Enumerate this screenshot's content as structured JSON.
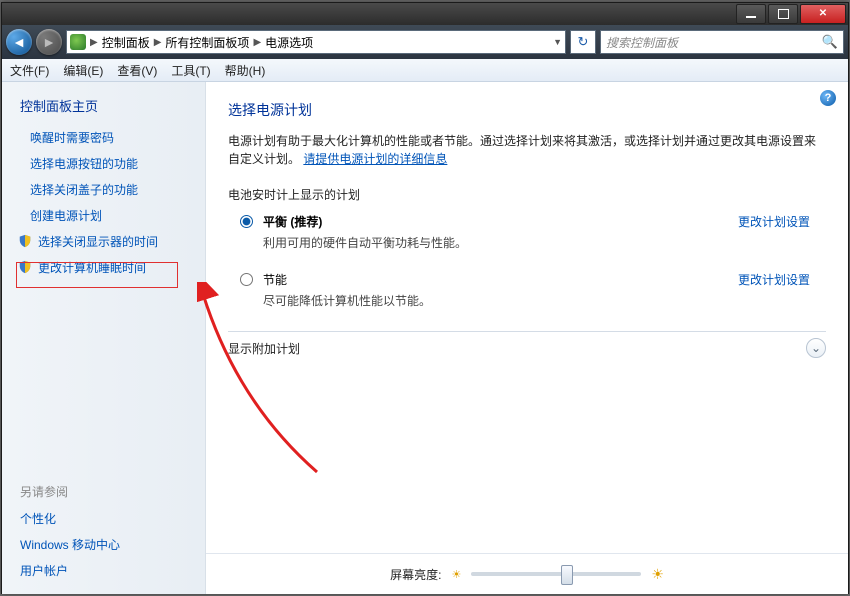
{
  "breadcrumb": {
    "root": "控制面板",
    "mid": "所有控制面板项",
    "leaf": "电源选项"
  },
  "search": {
    "placeholder": "搜索控制面板"
  },
  "menu": {
    "file": "文件(F)",
    "edit": "编辑(E)",
    "view": "查看(V)",
    "tools": "工具(T)",
    "help": "帮助(H)"
  },
  "sidebar": {
    "head": "控制面板主页",
    "links": [
      "唤醒时需要密码",
      "选择电源按钮的功能",
      "选择关闭盖子的功能",
      "创建电源计划",
      "选择关闭显示器的时间",
      "更改计算机睡眠时间"
    ],
    "seealso": "另请参阅",
    "extras": [
      "个性化",
      "Windows 移动中心",
      "用户帐户"
    ]
  },
  "content": {
    "title": "选择电源计划",
    "desc": "电源计划有助于最大化计算机的性能或者节能。通过选择计划来将其激活，或选择计划并通过更改其电源设置来自定义计划。",
    "desclink": "请提供电源计划的详细信息",
    "batterySection": "电池安时计上显示的计划",
    "plan1": {
      "name": "平衡 (推荐)",
      "sub": "利用可用的硬件自动平衡功耗与性能。",
      "link": "更改计划设置"
    },
    "plan2": {
      "name": "节能",
      "sub": "尽可能降低计算机性能以节能。",
      "link": "更改计划设置"
    },
    "addplans": "显示附加计划",
    "brightness": "屏幕亮度:"
  }
}
